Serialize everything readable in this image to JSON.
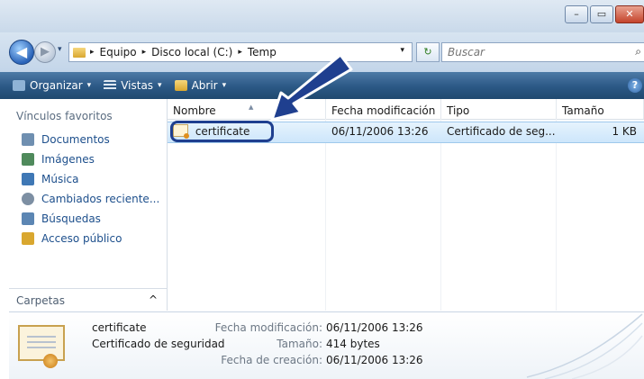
{
  "window": {
    "min": "–",
    "max": "▭",
    "close": "✕"
  },
  "nav": {
    "back": "◀",
    "forward": "▶",
    "history": "▾"
  },
  "address": {
    "crumbs": [
      "Equipo",
      "Disco local (C:)",
      "Temp"
    ],
    "separator": "▸",
    "dropdown": "▾",
    "refresh": "↻"
  },
  "search": {
    "placeholder": "Buscar",
    "icon": "⌕"
  },
  "toolbar": {
    "organizar": "Organizar",
    "vistas": "Vistas",
    "abrir": "Abrir",
    "arrow": "▾",
    "help": "?"
  },
  "sidebar": {
    "heading": "Vínculos favoritos",
    "items": [
      {
        "label": "Documentos",
        "icon": "documents-icon",
        "color": "#6f8fb0"
      },
      {
        "label": "Imágenes",
        "icon": "pictures-icon",
        "color": "#4f8a5c"
      },
      {
        "label": "Música",
        "icon": "music-icon",
        "color": "#3f78b5"
      },
      {
        "label": "Cambiados reciente...",
        "icon": "recent-icon",
        "color": "#7d8fa3"
      },
      {
        "label": "Búsquedas",
        "icon": "searches-icon",
        "color": "#5c86b3"
      },
      {
        "label": "Acceso público",
        "icon": "public-folder-icon",
        "color": "#d9a72f"
      }
    ],
    "folders_label": "Carpetas",
    "folders_chevron": "^"
  },
  "columns": {
    "name": "Nombre",
    "date": "Fecha modificación",
    "type": "Tipo",
    "size": "Tamaño"
  },
  "files": [
    {
      "name": "certificate",
      "date": "06/11/2006 13:26",
      "type": "Certificado de seg...",
      "size": "1 KB"
    }
  ],
  "details": {
    "name": "certificate",
    "type": "Certificado de seguridad",
    "modified_label": "Fecha modificación:",
    "modified": "06/11/2006 13:26",
    "size_label": "Tamaño:",
    "size": "414 bytes",
    "created_label": "Fecha de creación:",
    "created": "06/11/2006 13:26"
  },
  "colors": {
    "toolbar": "#2b5885",
    "selection": "#cde6fb",
    "arrow": "#1f3f8f",
    "link": "#1d4f8c"
  }
}
